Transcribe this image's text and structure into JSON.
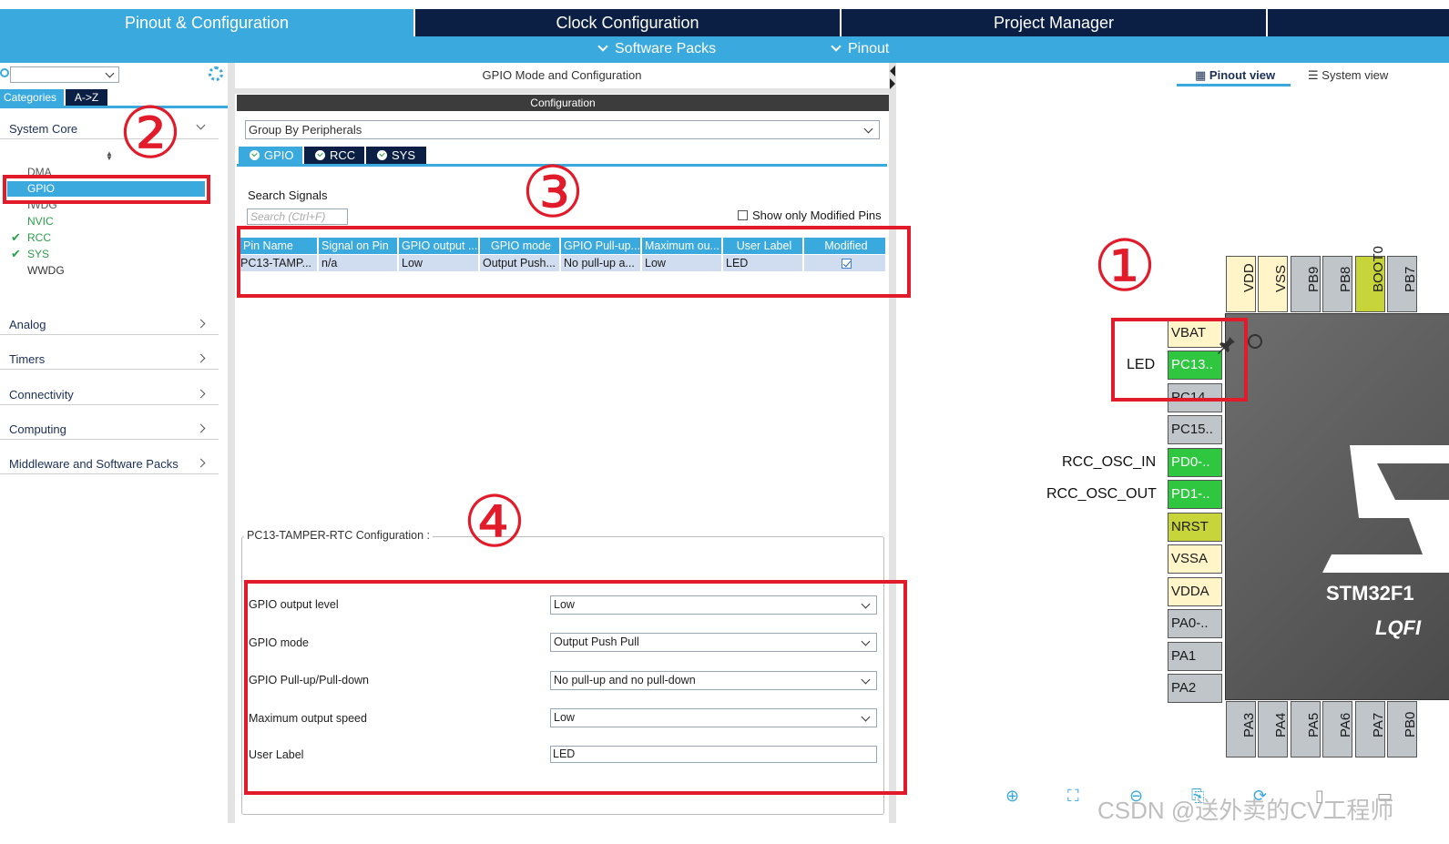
{
  "top_tabs": [
    "Pinout & Configuration",
    "Clock Configuration",
    "Project Manager"
  ],
  "subbar": {
    "software_packs": "Software Packs",
    "pinout": "Pinout"
  },
  "left": {
    "tabs": {
      "categories": "Categories",
      "az": "A->Z"
    },
    "system_core": "System Core",
    "system_core_items": [
      {
        "label": "DMA",
        "checked": false
      },
      {
        "label": "GPIO",
        "checked": false,
        "selected": true
      },
      {
        "label": "IWDG",
        "checked": false
      },
      {
        "label": "NVIC",
        "checked": false
      },
      {
        "label": "RCC",
        "checked": true
      },
      {
        "label": "SYS",
        "checked": true
      },
      {
        "label": "WWDG",
        "checked": false
      }
    ],
    "sections": [
      "Analog",
      "Timers",
      "Connectivity",
      "Computing",
      "Middleware and Software Packs"
    ]
  },
  "middle": {
    "title": "GPIO Mode and Configuration",
    "config_bar": "Configuration",
    "group_by": "Group By Peripherals",
    "tabs": [
      "GPIO",
      "RCC",
      "SYS"
    ],
    "search_label": "Search Signals",
    "search_placeholder": "Search (Ctrl+F)",
    "show_modified": "Show only Modified Pins",
    "table": {
      "headers": [
        "Pin Name",
        "Signal on Pin",
        "GPIO output ...",
        "GPIO mode",
        "GPIO Pull-up...",
        "Maximum ou...",
        "User Label",
        "Modified"
      ],
      "rows": [
        [
          "PC13-TAMP...",
          "n/a",
          "Low",
          "Output Push...",
          "No pull-up a...",
          "Low",
          "LED",
          "checked"
        ]
      ]
    },
    "pin_config": {
      "legend": "PC13-TAMPER-RTC Configuration :",
      "fields": [
        {
          "label": "GPIO output level",
          "value": "Low"
        },
        {
          "label": "GPIO mode",
          "value": "Output Push Pull"
        },
        {
          "label": "GPIO Pull-up/Pull-down",
          "value": "No pull-up and no pull-down"
        },
        {
          "label": "Maximum output speed",
          "value": "Low"
        },
        {
          "label": "User Label",
          "value": "LED"
        }
      ]
    }
  },
  "right": {
    "tabs": {
      "pinout_view": "Pinout view",
      "system_view": "System view"
    },
    "top_pins": [
      "VDD",
      "VSS",
      "PB9",
      "PB8",
      "BOOT0",
      "PB7"
    ],
    "left_pins": [
      "VBAT",
      "PC13..",
      "PC14..",
      "PC15..",
      "PD0-..",
      "PD1-..",
      "NRST",
      "VSSA",
      "VDDA",
      "PA0-..",
      "PA1",
      "PA2"
    ],
    "bottom_pins": [
      "PA3",
      "PA4",
      "PA5",
      "PA6",
      "PA7",
      "PB0"
    ],
    "pin_labels": {
      "led": "LED",
      "osc_in": "RCC_OSC_IN",
      "osc_out": "RCC_OSC_OUT"
    },
    "chip_name": "STM32F1",
    "chip_package": "LQFI"
  },
  "annotations": [
    "①",
    "②",
    "③",
    "④"
  ],
  "watermark": "CSDN @送外卖的CV工程师"
}
